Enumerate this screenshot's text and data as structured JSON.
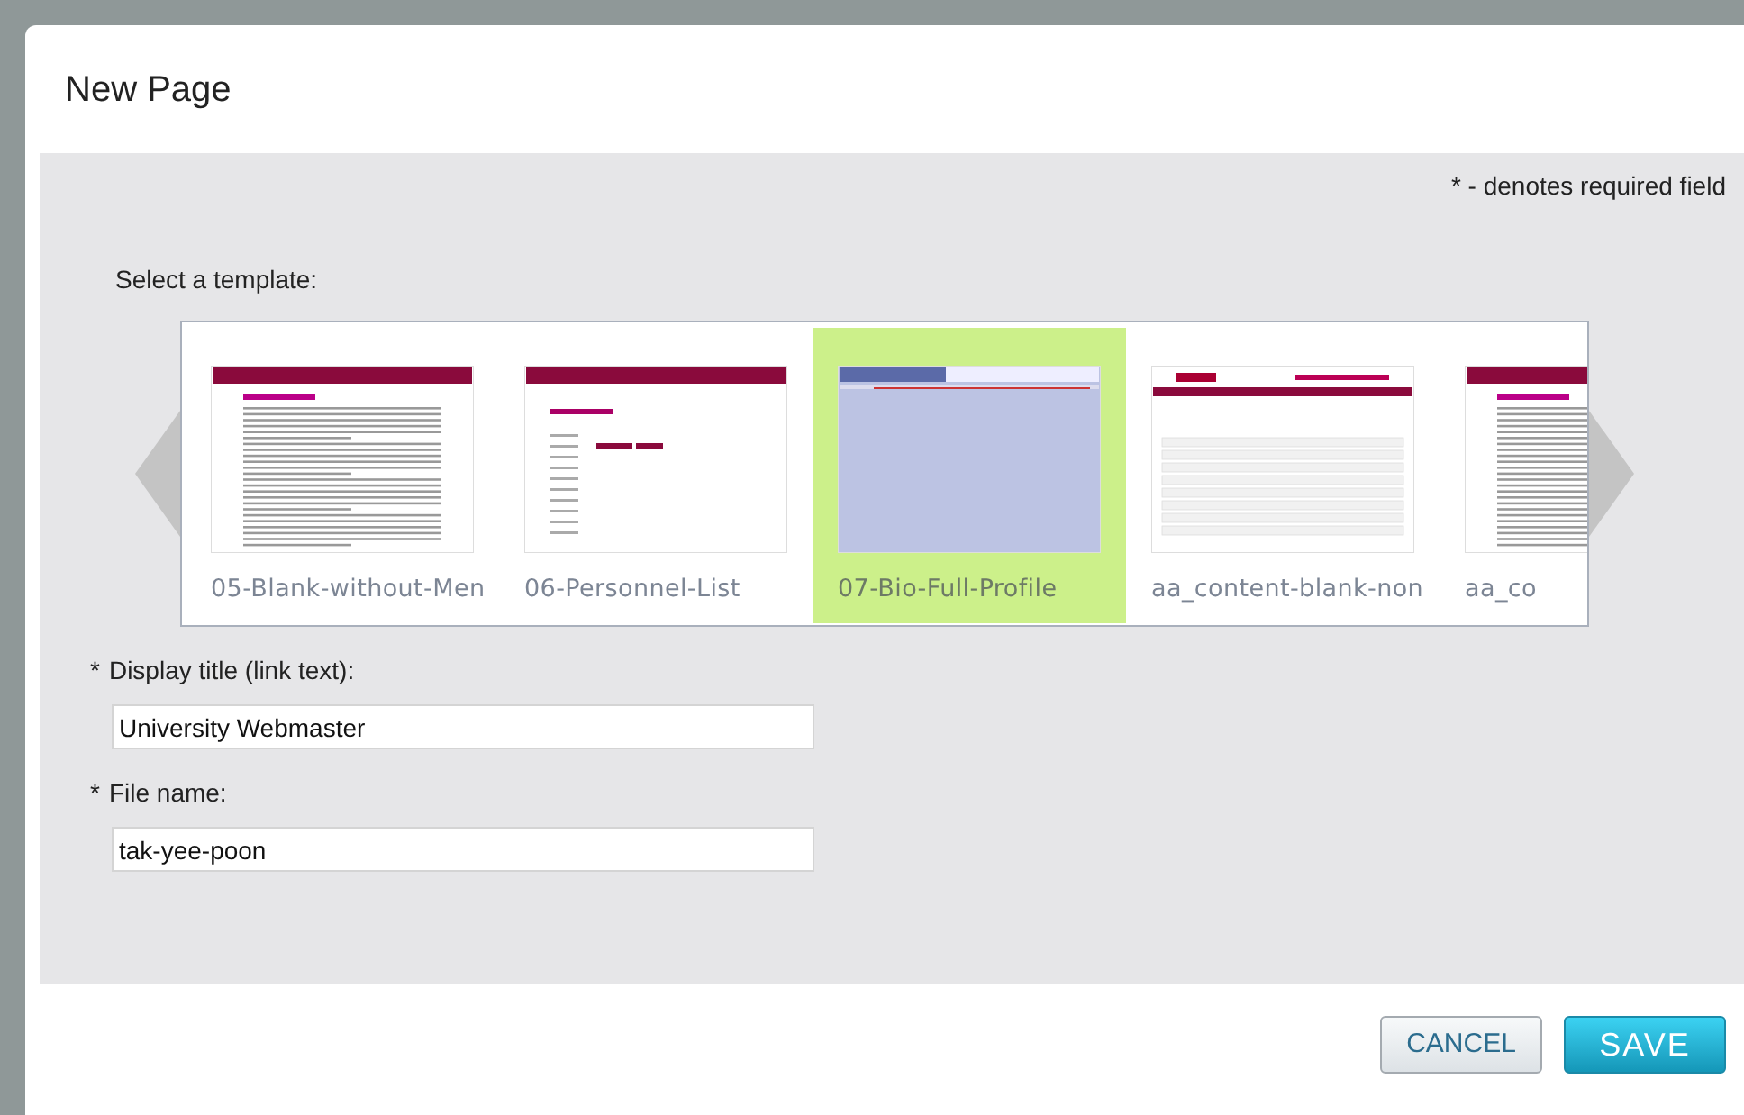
{
  "dialog": {
    "title": "New Page"
  },
  "required_note": "* - denotes required field",
  "template_label": "Select a template:",
  "templates": [
    {
      "label": "05-Blank-without-Men",
      "kind": "text-page",
      "selected": false
    },
    {
      "label": "06-Personnel-List",
      "kind": "list-page",
      "selected": false
    },
    {
      "label": "07-Bio-Full-Profile",
      "kind": "profile-page",
      "selected": true
    },
    {
      "label": "aa_content-blank-non",
      "kind": "form-page",
      "selected": false
    },
    {
      "label": "aa_co",
      "kind": "text-page",
      "selected": false
    }
  ],
  "fields": [
    {
      "required_mark": "*",
      "label": "Display title (link text):",
      "value": "University Webmaster"
    },
    {
      "required_mark": "*",
      "label": "File name:",
      "value": "tak-yee-poon"
    }
  ],
  "buttons": [
    {
      "label": "CANCEL",
      "kind": "secondary"
    },
    {
      "label": "SAVE",
      "kind": "primary"
    }
  ]
}
